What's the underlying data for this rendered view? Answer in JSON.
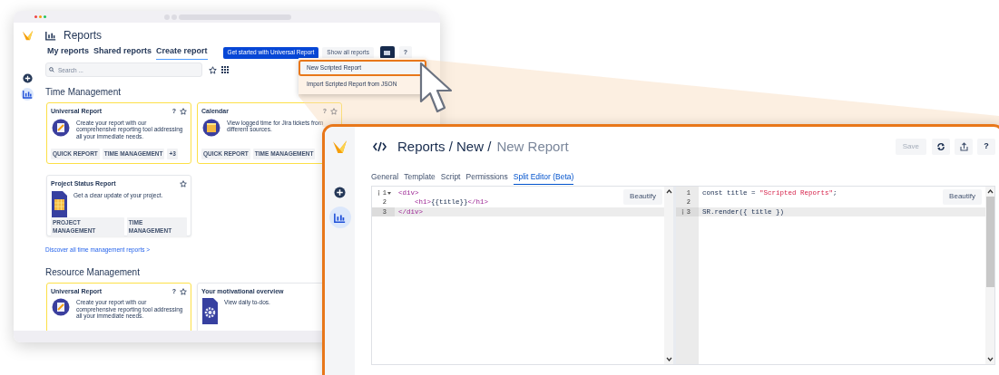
{
  "back_window": {
    "sidebar": [
      {
        "kind": "add",
        "selected": false
      },
      {
        "kind": "reports",
        "selected": true
      }
    ],
    "title": "Reports",
    "tabs": [
      {
        "label": "My reports",
        "selected": false
      },
      {
        "label": "Shared reports",
        "selected": false
      },
      {
        "label": "Create report",
        "selected": true
      }
    ],
    "primary_button": "Get started with Universal Report",
    "secondary_button": "Show all reports",
    "help_button": "?",
    "menu": {
      "items": [
        {
          "label": "New Scripted Report",
          "highlighted": true
        },
        {
          "label": "Import Scripted Report from JSON",
          "highlighted": false
        }
      ]
    },
    "search": {
      "placeholder": "Search ..."
    },
    "sections": [
      {
        "title": "Time Management",
        "cards": [
          {
            "title": "Universal Report",
            "help": "?",
            "kind": "universal",
            "featured": true,
            "description": "Create your report with our comprehensive reporting tool addressing all your immediate needs.",
            "tags": [
              "QUICK REPORT",
              "TIME MANAGEMENT",
              "+3"
            ]
          },
          {
            "title": "Calendar",
            "help": "?",
            "kind": "calendar",
            "featured": true,
            "description": "View logged time for Jira tickets from different sources.",
            "tags": [
              "QUICK REPORT",
              "TIME MANAGEMENT"
            ]
          },
          {
            "title": "Project Status Report",
            "kind": "table-document",
            "featured": false,
            "description": "Get a clear update of your project.",
            "tags": [
              "PROJECT MANAGEMENT",
              "TIME MANAGEMENT"
            ]
          }
        ],
        "link": "Discover all time management reports >"
      },
      {
        "title": "Resource Management",
        "cards": [
          {
            "title": "Universal Report",
            "help": "?",
            "kind": "universal",
            "featured": true,
            "description": "Create your report with our comprehensive reporting tool addressing all your immediate needs."
          },
          {
            "title": "Your motivational overview",
            "kind": "gear-document",
            "featured": false,
            "description": "View daily to-dos."
          }
        ]
      }
    ]
  },
  "front_window": {
    "sidebar": [
      {
        "kind": "add",
        "selected": false
      },
      {
        "kind": "reports",
        "selected": true
      }
    ],
    "breadcrumb": "Reports / New /",
    "title": "New Report",
    "save_button": {
      "label": "Save",
      "disabled": true
    },
    "help_button": "?",
    "tabs": [
      {
        "label": "General",
        "selected": false
      },
      {
        "label": "Template",
        "selected": false
      },
      {
        "label": "Script",
        "selected": false
      },
      {
        "label": "Permissions",
        "selected": false
      },
      {
        "label": "Split Editor (Beta)",
        "selected": true
      }
    ],
    "editors": [
      {
        "beautify": "Beautify",
        "lines": [
          {
            "number": "1",
            "annotated": true,
            "foldable": true,
            "active": false,
            "tokens": [
              {
                "kind": "tag",
                "text": "<div>"
              }
            ]
          },
          {
            "number": "2",
            "annotated": false,
            "foldable": false,
            "active": false,
            "tokens": [
              {
                "kind": "tag",
                "text": "    <h1>"
              },
              {
                "kind": "plain",
                "text": "{{title}}"
              },
              {
                "kind": "tag",
                "text": "</h1>"
              }
            ]
          },
          {
            "number": "3",
            "annotated": false,
            "foldable": false,
            "active": true,
            "tokens": [
              {
                "kind": "tag",
                "text": "</div>"
              }
            ]
          }
        ]
      },
      {
        "beautify": "Beautify",
        "lines": [
          {
            "number": "1",
            "annotated": false,
            "foldable": false,
            "active": false,
            "tokens": [
              {
                "kind": "plain",
                "text": "const title = "
              },
              {
                "kind": "string",
                "text": "\"Scripted Reports\""
              },
              {
                "kind": "plain",
                "text": ";"
              }
            ]
          },
          {
            "number": "2",
            "annotated": false,
            "foldable": false,
            "active": false
          },
          {
            "number": "3",
            "annotated": true,
            "foldable": false,
            "active": true,
            "tokens": [
              {
                "kind": "plain",
                "text": "SR.render({ title })"
              }
            ]
          }
        ]
      }
    ]
  }
}
